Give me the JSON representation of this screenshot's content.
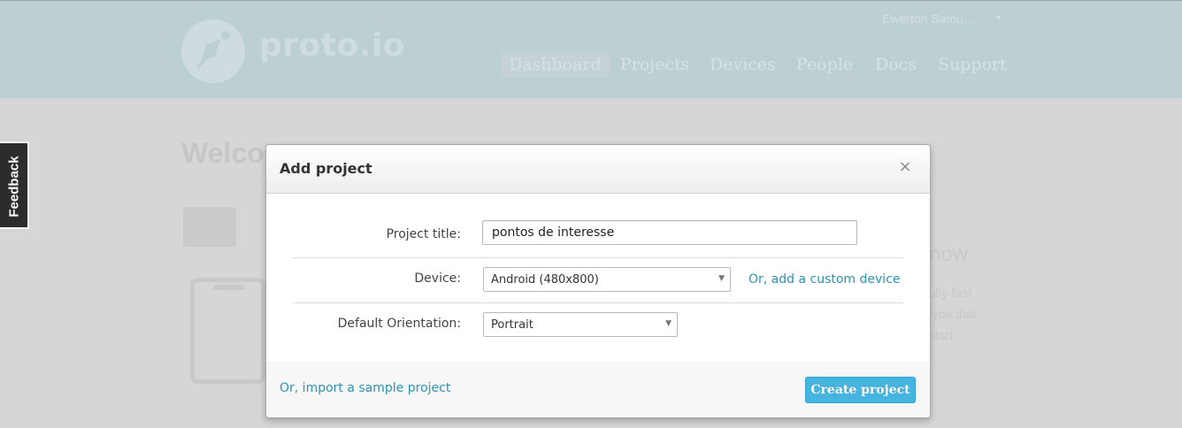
{
  "header": {
    "logo_text": "proto.io",
    "user_name": "Ewerton Samu...",
    "user_caret": "▾",
    "nav": [
      {
        "label": "Dashboard",
        "active": true
      },
      {
        "label": "Projects",
        "active": false
      },
      {
        "label": "Devices",
        "active": false
      },
      {
        "label": "People",
        "active": false
      },
      {
        "label": "Docs",
        "active": false
      },
      {
        "label": "Support",
        "active": false
      }
    ]
  },
  "page": {
    "welcome": "Welco",
    "side_heading": "now",
    "side_lines": [
      "ully-fast",
      "type that",
      "start."
    ]
  },
  "feedback": {
    "label": "Feedback"
  },
  "modal": {
    "title": "Add project",
    "close_glyph": "×",
    "fields": {
      "project_title": {
        "label": "Project title:",
        "value": "pontos de interesse"
      },
      "device": {
        "label": "Device:",
        "value": "Android (480x800)",
        "link": "Or, add a custom device"
      },
      "orientation": {
        "label": "Default Orientation:",
        "value": "Portrait"
      }
    },
    "footer": {
      "import_link": "Or, import a sample project",
      "create_button": "Create project"
    }
  },
  "colors": {
    "header_bg": "#bccfd3",
    "overlay_bg": "#d6d6d6",
    "link": "#2b93b3",
    "primary_button": "#45b5e0"
  }
}
